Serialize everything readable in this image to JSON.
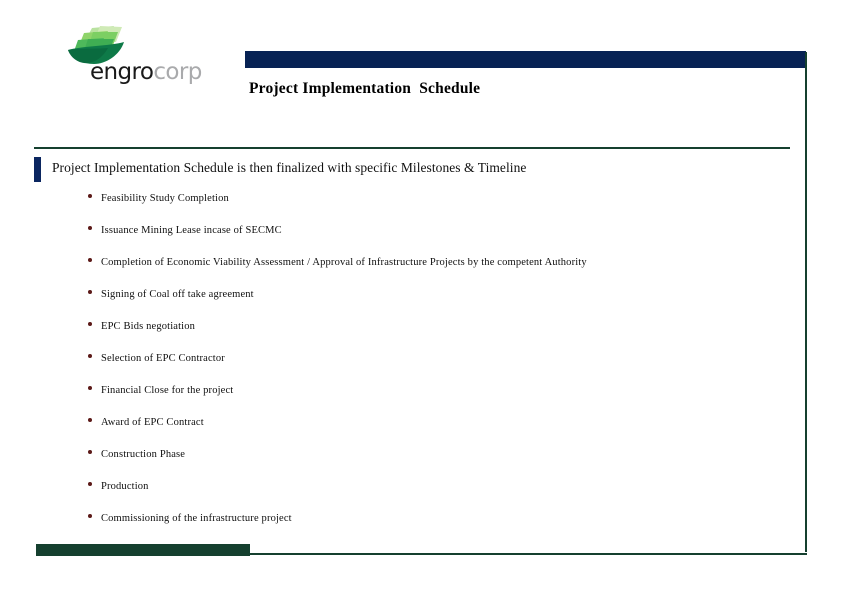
{
  "logo": {
    "mark_name": "engro-leaf-mark",
    "word_primary": "engro",
    "word_secondary": "corp",
    "colors": {
      "leaf_dark": "#0e7a48",
      "leaf_mid": "#4eb95b",
      "leaf_light": "#8fd46a",
      "leaf_pale": "#b9e2a0",
      "word_primary": "#1a1a1a",
      "word_secondary": "#a9aaac"
    }
  },
  "header": {
    "title": "Project Implementation  Schedule",
    "band_color": "#072254"
  },
  "subtitle": {
    "text": "Project Implementation Schedule is then finalized with specific Milestones & Timeline",
    "tab_color": "#0b2660"
  },
  "frame": {
    "rule_color": "#15402f"
  },
  "bullets": {
    "marker_color": "#5c1a18",
    "items": [
      {
        "label": "Feasibility Study Completion"
      },
      {
        "label": "Issuance Mining Lease incase of  SECMC"
      },
      {
        "label": "Completion of Economic Viability Assessment / Approval of Infrastructure Projects by the competent Authority"
      },
      {
        "label": "Signing of Coal off take agreement"
      },
      {
        "label": "EPC Bids negotiation"
      },
      {
        "label": "Selection of EPC Contractor"
      },
      {
        "label": "Financial Close for the project"
      },
      {
        "label": "Award of EPC Contract"
      },
      {
        "label": "Construction Phase"
      },
      {
        "label": "Production"
      },
      {
        "label": "Commissioning of the infrastructure project"
      }
    ]
  }
}
